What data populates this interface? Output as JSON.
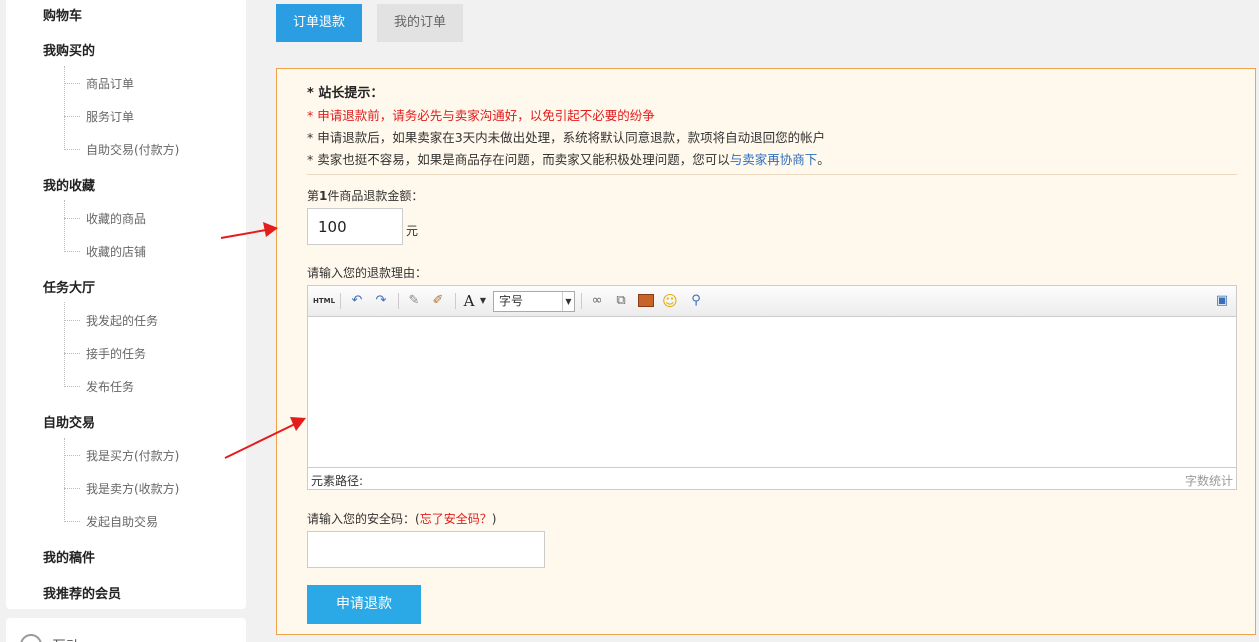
{
  "sidebar": {
    "groups": [
      {
        "label": "购物车",
        "items": []
      },
      {
        "label": "我购买的",
        "items": [
          "商品订单",
          "服务订单",
          "自助交易(付款方)"
        ]
      },
      {
        "label": "我的收藏",
        "items": [
          "收藏的商品",
          "收藏的店铺"
        ]
      },
      {
        "label": "任务大厅",
        "items": [
          "我发起的任务",
          "接手的任务",
          "发布任务"
        ]
      },
      {
        "label": "自助交易",
        "items": [
          "我是买方(付款方)",
          "我是卖方(收款方)",
          "发起自助交易"
        ]
      },
      {
        "label": "我的稿件",
        "items": []
      },
      {
        "label": "我推荐的会员",
        "items": []
      }
    ],
    "footer_label": "互动"
  },
  "tabs": [
    {
      "label": "订单退款",
      "active": true
    },
    {
      "label": "我的订单",
      "active": false
    }
  ],
  "tips": {
    "title": "* 站长提示：",
    "line1": "* 申请退款前，请务必先与卖家沟通好，以免引起不必要的纷争",
    "line2": "* 申请退款后，如果卖家在3天内未做出处理，系统将默认同意退款，款项将自动退回您的帐户",
    "line3_prefix": "* 卖家也挺不容易，如果是商品存在问题，而卖家又能积极处理问题，您可以",
    "line3_link": "与卖家再协商下",
    "line3_suffix": "。"
  },
  "amount": {
    "label_prefix": "第",
    "label_num": "1",
    "label_suffix": "件商品退款金额：",
    "value": "100",
    "unit": "元"
  },
  "reason": {
    "label": "请输入您的退款理由：",
    "toolbar": {
      "html_label": "HTML",
      "font_label": "A",
      "font_size_label": "字号"
    },
    "path_label": "元素路径:",
    "word_count_label": "字数统计"
  },
  "security": {
    "label": "请输入您的安全码：",
    "forgot_open": "(",
    "forgot_link": "忘了安全码？",
    "forgot_close": ")"
  },
  "submit_label": "申请退款",
  "colors": {
    "primary": "#2b9ee3",
    "panel_bg": "#fff8ec",
    "panel_border": "#f0a34d",
    "warn": "#e21b1b",
    "arrow": "#e31c1c"
  }
}
